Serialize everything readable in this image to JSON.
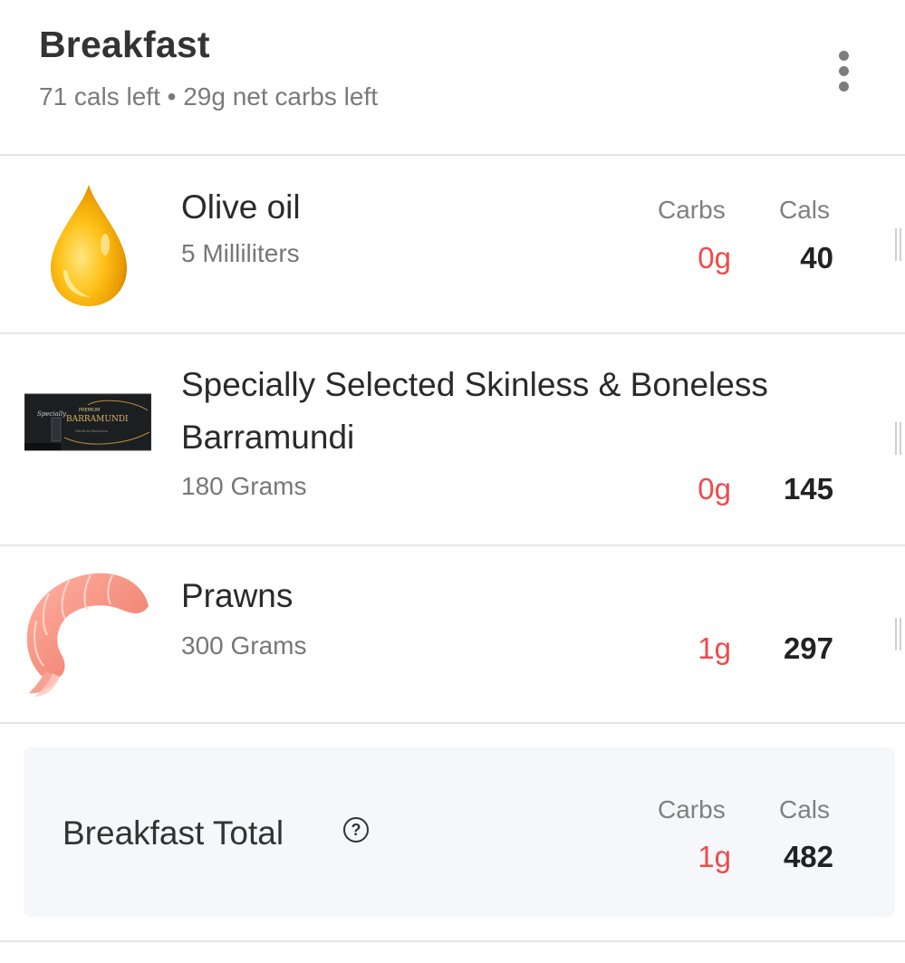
{
  "meal": {
    "title": "Breakfast",
    "subtitle": "71 cals left • 29g net carbs left"
  },
  "icons": {
    "menu": "more-vertical-icon",
    "help": "help-circle-icon",
    "drag": "drag-handle-icon"
  },
  "columns": {
    "carbs": "Carbs",
    "cals": "Cals"
  },
  "items": [
    {
      "name": "Olive oil",
      "quantity": "5 Milliliters",
      "carbs": "0g",
      "cals": "40",
      "thumb": "olive-oil-drop-icon"
    },
    {
      "name": "Specially Selected Skinless & Boneless Barramundi",
      "quantity": "180 Grams",
      "carbs": "0g",
      "cals": "145",
      "thumb": "barramundi-package-image"
    },
    {
      "name": "Prawns",
      "quantity": "300 Grams",
      "carbs": "1g",
      "cals": "297",
      "thumb": "prawn-icon"
    }
  ],
  "total": {
    "label": "Breakfast Total",
    "help_glyph": "?",
    "carbs": "1g",
    "cals": "482"
  },
  "colors": {
    "carbs_value": "#f04a4a",
    "total_bg": "#f5f7fa",
    "divider": "#e6e6e6"
  }
}
